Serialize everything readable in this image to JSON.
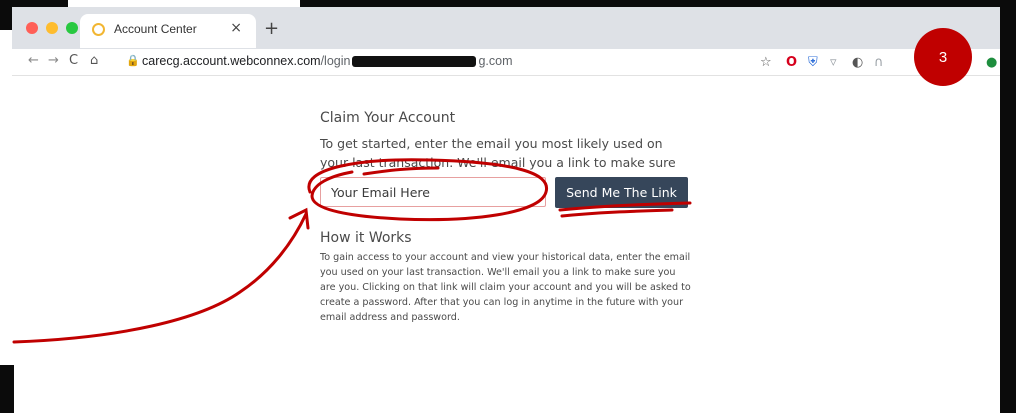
{
  "browser": {
    "tab_title": "Account Center",
    "tab_close": "×",
    "new_tab": "+",
    "url_host": "carecg.account.webconnex.com",
    "url_path_start": "/login",
    "url_path_end": "g.com",
    "icons": {
      "back": "arrow-left",
      "forward": "arrow-right",
      "reload": "reload",
      "home": "home",
      "lock": "lock",
      "star": "star"
    }
  },
  "badge": {
    "number": "3",
    "color": "#c00000"
  },
  "page": {
    "claim_title": "Claim Your Account",
    "claim_description": "To get started, enter the email you most likely used on your last transaction. We'll email you a link to make sure you are you.",
    "email_placeholder": "Your Email Here",
    "send_button_label": "Send Me The Link",
    "how_title": "How it Works",
    "how_body": "To gain access to your account and view your historical data, enter the email you used on your last transaction. We'll email you a link to make sure you are you. Clicking on that link will claim your account and you will be asked to create a password. After that you can log in anytime in the future with your email address and password."
  },
  "colors": {
    "button_bg": "#36465a",
    "annotation_red": "#c00000",
    "input_border": "#e7a0a0"
  }
}
